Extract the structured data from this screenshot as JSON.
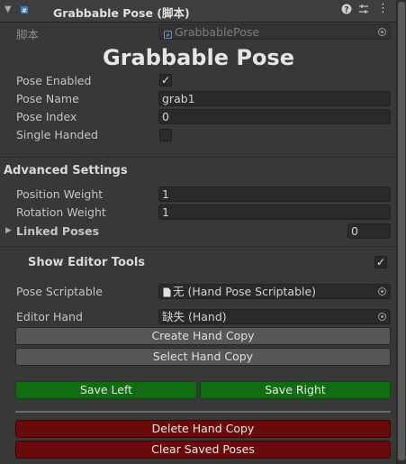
{
  "header": {
    "title": "Grabbable Pose  (脚本)",
    "help_icon": "help-icon",
    "preset_icon": "preset-icon",
    "menu_icon": "more-icon"
  },
  "script_field": {
    "label": "脚本",
    "value": "GrabbablePose"
  },
  "big_title": "Grabbable Pose",
  "fields": {
    "pose_enabled": {
      "label": "Pose Enabled",
      "checked": true
    },
    "pose_name": {
      "label": "Pose Name",
      "value": "grab1"
    },
    "pose_index": {
      "label": "Pose Index",
      "value": "0"
    },
    "single_handed": {
      "label": "Single Handed",
      "checked": false
    }
  },
  "advanced": {
    "title": "Advanced Settings",
    "position_weight": {
      "label": "Position Weight",
      "value": "1"
    },
    "rotation_weight": {
      "label": "Rotation Weight",
      "value": "1"
    },
    "linked_poses": {
      "label": "Linked Poses",
      "value": "0"
    }
  },
  "editor_tools": {
    "title": "Show Editor Tools",
    "checked": true,
    "pose_scriptable": {
      "label": "Pose Scriptable",
      "value": "无 (Hand Pose Scriptable)"
    },
    "editor_hand": {
      "label": "Editor Hand",
      "value": "缺失 (Hand)"
    },
    "create_copy": "Create Hand Copy",
    "select_copy": "Select Hand Copy",
    "save_left": "Save Left",
    "save_right": "Save Right",
    "delete_copy": "Delete Hand Copy",
    "clear_poses": "Clear Saved Poses"
  },
  "colors": {
    "green_button": "#126d12",
    "red_button": "#6b0a0a",
    "background": "#383838"
  }
}
